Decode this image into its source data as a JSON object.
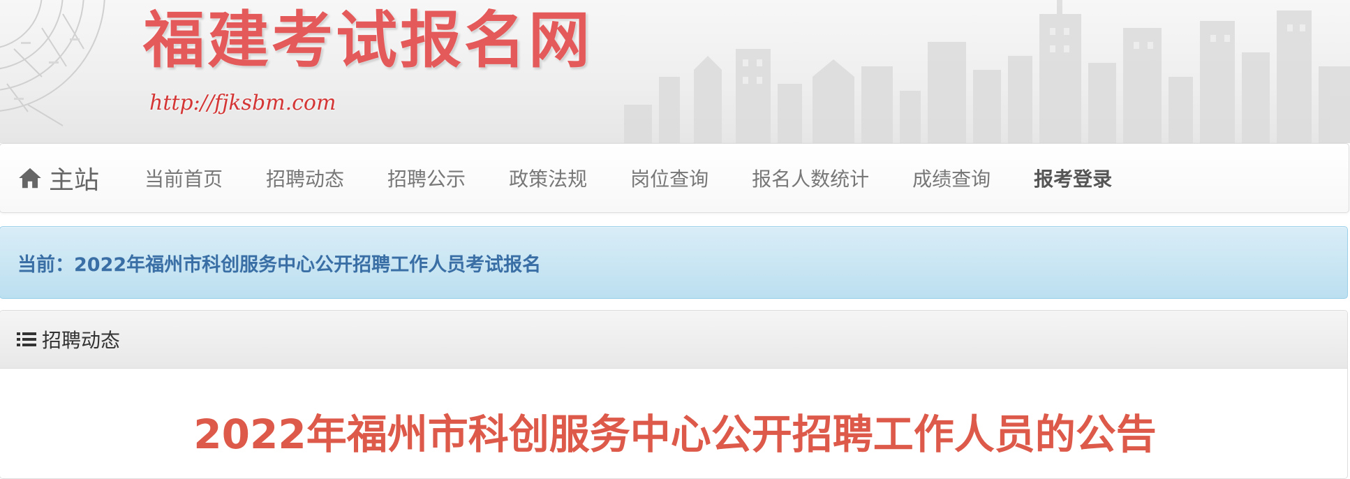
{
  "banner": {
    "site_title": "福建考试报名网",
    "site_url": "http://fjksbm.com",
    "title_color": "#e45a5a"
  },
  "navbar": {
    "brand_icon": "home-icon",
    "brand_label": "主站",
    "items": [
      {
        "label": "当前首页"
      },
      {
        "label": "招聘动态"
      },
      {
        "label": "招聘公示"
      },
      {
        "label": "政策法规"
      },
      {
        "label": "岗位查询"
      },
      {
        "label": "报名人数统计"
      },
      {
        "label": "成绩查询"
      },
      {
        "label": "报考登录",
        "emphasized": true
      }
    ]
  },
  "current": {
    "text": "当前：2022年福州市科创服务中心公开招聘工作人员考试报名",
    "color": "#3a6fa6",
    "background": "#d9edf7"
  },
  "panel": {
    "icon": "list-icon",
    "heading": "招聘动态",
    "article_title": "2022年福州市科创服务中心公开招聘工作人员的公告",
    "article_title_color": "#dd5a4a"
  }
}
